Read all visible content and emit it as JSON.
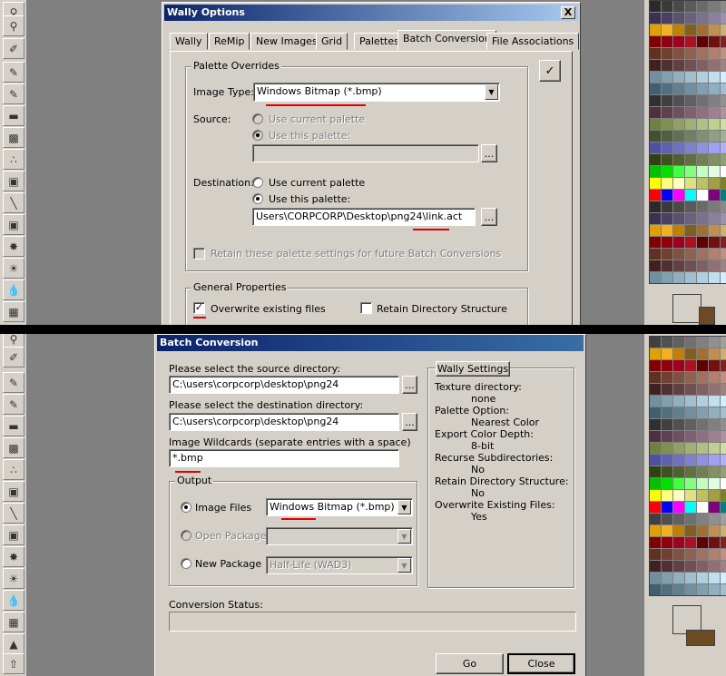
{
  "wally_options": {
    "title": "Wally Options",
    "close_label": "X",
    "tabs": [
      "Wally",
      "ReMip",
      "New Images",
      "Grid",
      "Palettes",
      "Batch Conversion",
      "File Associations"
    ],
    "palette_overrides": {
      "legend": "Palette Overrides",
      "image_type_label": "Image Type:",
      "image_type_value": "Windows Bitmap (*.bmp)",
      "source_label": "Source:",
      "source_opt1": "Use current palette",
      "source_opt2": "Use this palette:",
      "source_path": "",
      "browse_label": "...",
      "destination_label": "Destination:",
      "dest_opt1": "Use current palette",
      "dest_opt2": "Use this palette:",
      "dest_path": "Users\\CORPCORP\\Desktop\\png24\\link.act",
      "retain_label": "Retain these palette settings for future Batch Conversions"
    },
    "general": {
      "legend": "General Properties",
      "overwrite_label": "Overwrite existing files",
      "overwrite_checked": true,
      "retain_dir_label": "Retain Directory Structure"
    }
  },
  "batch_conversion": {
    "title": "Batch Conversion",
    "source_label": "Please select the source directory:",
    "source_value": "C:\\users\\corpcorp\\desktop\\png24",
    "dest_label": "Please select the destination directory:",
    "dest_value": "C:\\users\\corpcorp\\desktop\\png24",
    "wildcards_label": "Image Wildcards (separate entries with a space)",
    "wildcards_value": "*.bmp",
    "browse_label": "...",
    "output": {
      "legend": "Output",
      "image_files_label": "Image Files",
      "image_files_value": "Windows Bitmap (*.bmp)",
      "open_package_label": "Open Package",
      "open_package_value": "",
      "new_package_label": "New Package",
      "new_package_value": "Half-Life (WAD3)"
    },
    "wally_settings": {
      "legend": "Wally Settings",
      "items": [
        {
          "k": "Texture directory:",
          "v": "none"
        },
        {
          "k": "Palette Option:",
          "v": "Nearest Color"
        },
        {
          "k": "Export Color Depth:",
          "v": "8-bit"
        },
        {
          "k": "Recurse Subdirectories:",
          "v": "No"
        },
        {
          "k": "Retain Directory Structure:",
          "v": "No"
        },
        {
          "k": "Overwrite Existing Files:",
          "v": "Yes"
        }
      ]
    },
    "status_label": "Conversion Status:",
    "go_label": "Go",
    "close_label": "Close"
  },
  "colors": {
    "accent_underline": "#e00000",
    "titlebar_start": "#0a246a",
    "face": "#d4d0c8"
  },
  "toolbar_icons": [
    "magnifier-icon",
    "eyedropper-icon",
    "pencil-icon",
    "brush-icon",
    "eraser-icon",
    "fill-icon",
    "spray-icon",
    "clone-icon",
    "line-icon",
    "blend-icon",
    "sharpen-icon",
    "burn-icon",
    "smudge-icon"
  ],
  "palette_colors": [
    "#2a2a2a",
    "#3a3a3a",
    "#4a4a4a",
    "#5a5a5a",
    "#6a6a6a",
    "#7a7a7a",
    "#8a8a8a",
    "#3a3050",
    "#4a4060",
    "#5a5070",
    "#6a6080",
    "#7a7090",
    "#8a80a0",
    "#9a90b0",
    "#e0a000",
    "#f0b020",
    "#c08000",
    "#806020",
    "#a07030",
    "#c09050",
    "#d0b070",
    "#800000",
    "#900010",
    "#a00020",
    "#b01020",
    "#600000",
    "#701010",
    "#802020",
    "#603020",
    "#704030",
    "#805040",
    "#906050",
    "#a07060",
    "#b08070",
    "#c09080",
    "#402020",
    "#503030",
    "#604040",
    "#705050",
    "#806060",
    "#907070",
    "#a08080",
    "#7090a0",
    "#80a0b0",
    "#90b0c0",
    "#a0c0d0",
    "#b0d0e0",
    "#c0e0f0",
    "#d0f0ff",
    "#406070",
    "#507080",
    "#608090",
    "#7090a0",
    "#80a0b0",
    "#90b0c0",
    "#a0c0d0",
    "#303030",
    "#404040",
    "#505050",
    "#606060",
    "#707070",
    "#808080",
    "#909090",
    "#503040",
    "#604050",
    "#705060",
    "#806070",
    "#907080",
    "#a08090",
    "#b090a0",
    "#708040",
    "#809050",
    "#90a060",
    "#a0b070",
    "#b0c080",
    "#c0d090",
    "#d0e0a0",
    "#405030",
    "#506040",
    "#607050",
    "#708060",
    "#809070",
    "#90a080",
    "#a0b090",
    "#5050a0",
    "#6060b0",
    "#7070c0",
    "#8080d0",
    "#9090e0",
    "#a0a0f0",
    "#b0b0ff",
    "#304010",
    "#405020",
    "#506030",
    "#607040",
    "#708050",
    "#809060",
    "#90a070",
    "#00c000",
    "#00e000",
    "#40ff40",
    "#80ff80",
    "#c0ffc0",
    "#e0ffe0",
    "#ffffff",
    "#ffff00",
    "#ffff80",
    "#ffffc0",
    "#e0e080",
    "#c0c060",
    "#a0a040",
    "#808020",
    "#ff0000",
    "#0000ff",
    "#ff00ff",
    "#00ffff",
    "#ffffff",
    "#800080",
    "#008080"
  ],
  "palette_colors_b": [
    "#404040",
    "#505050",
    "#606060",
    "#707070",
    "#808080",
    "#909090",
    "#a0a0a0",
    "#e0a000",
    "#f0b020",
    "#c08000",
    "#806020",
    "#a07030",
    "#c09050",
    "#d0b070",
    "#800000",
    "#900010",
    "#a00020",
    "#b01020",
    "#600000",
    "#701010",
    "#802020",
    "#603020",
    "#704030",
    "#805040",
    "#906050",
    "#a07060",
    "#b08070",
    "#c09080",
    "#402020",
    "#503030",
    "#604040",
    "#705050",
    "#806060",
    "#907070",
    "#a08080",
    "#7090a0",
    "#80a0b0",
    "#90b0c0",
    "#a0c0d0",
    "#b0d0e0",
    "#c0e0f0",
    "#d0f0ff",
    "#406070",
    "#507080",
    "#608090",
    "#7090a0",
    "#80a0b0",
    "#90b0c0",
    "#a0c0d0",
    "#303030",
    "#404040",
    "#505050",
    "#606060",
    "#707070",
    "#808080",
    "#909090",
    "#503040",
    "#604050",
    "#705060",
    "#806070",
    "#907080",
    "#a08090",
    "#b090a0",
    "#708040",
    "#809050",
    "#90a060",
    "#a0b070",
    "#b0c080",
    "#c0d090",
    "#d0e0a0",
    "#5050a0",
    "#6060b0",
    "#7070c0",
    "#8080d0",
    "#9090e0",
    "#a0a0f0",
    "#b0b0ff",
    "#304010",
    "#405020",
    "#506030",
    "#607040",
    "#708050",
    "#809060",
    "#90a070",
    "#00c000",
    "#00e000",
    "#40ff40",
    "#80ff80",
    "#c0ffc0",
    "#e0ffe0",
    "#ffffff",
    "#ffff00",
    "#ffff80",
    "#ffffc0",
    "#e0e080",
    "#c0c060",
    "#a0a040",
    "#808020",
    "#ff0000",
    "#0000ff",
    "#ff00ff",
    "#00ffff",
    "#ffffff",
    "#800080",
    "#008080"
  ]
}
